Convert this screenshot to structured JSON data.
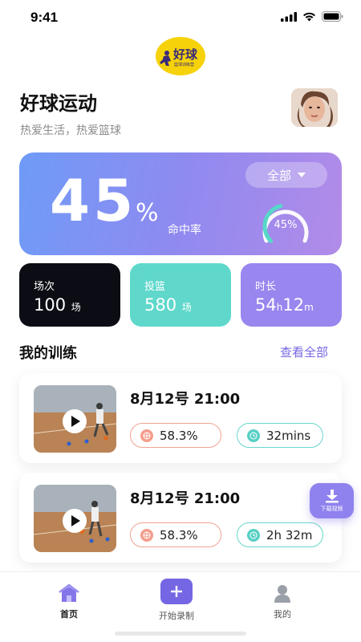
{
  "status": {
    "time": "9:41"
  },
  "header": {
    "logo_text": "好球",
    "logo_subtext": "篮球训练营",
    "title": "好球运动",
    "subtitle": "热爱生活，热爱篮球"
  },
  "hero": {
    "value": "45",
    "unit": "%",
    "label": "命中率",
    "filter": "全部",
    "ring_text": "45%",
    "ring_fraction": 0.45
  },
  "stats": [
    {
      "label": "场次",
      "value": "100",
      "unit": "场"
    },
    {
      "label": "投篮",
      "value": "580",
      "unit": "场"
    },
    {
      "label": "时长",
      "value_h": "54",
      "unit_h": "h",
      "value_m": "12",
      "unit_m": "m"
    }
  ],
  "training": {
    "title": "我的训练",
    "see_all": "查看全部",
    "items": [
      {
        "date": "8月12号  21:00",
        "rate": "58.3%",
        "duration": "32mins"
      },
      {
        "date": "8月12号  21:00",
        "rate": "58.3%",
        "duration": "2h 32m"
      }
    ]
  },
  "download": {
    "label": "下载视频"
  },
  "tabs": [
    {
      "label": "首页"
    },
    {
      "label": "开始录制"
    },
    {
      "label": "我的"
    }
  ],
  "colors": {
    "accent": "#7567e3",
    "teal": "#5fd8cb",
    "dark": "#0c0d14",
    "purple": "#9a86ef",
    "rate_red": "#f49d8c"
  }
}
